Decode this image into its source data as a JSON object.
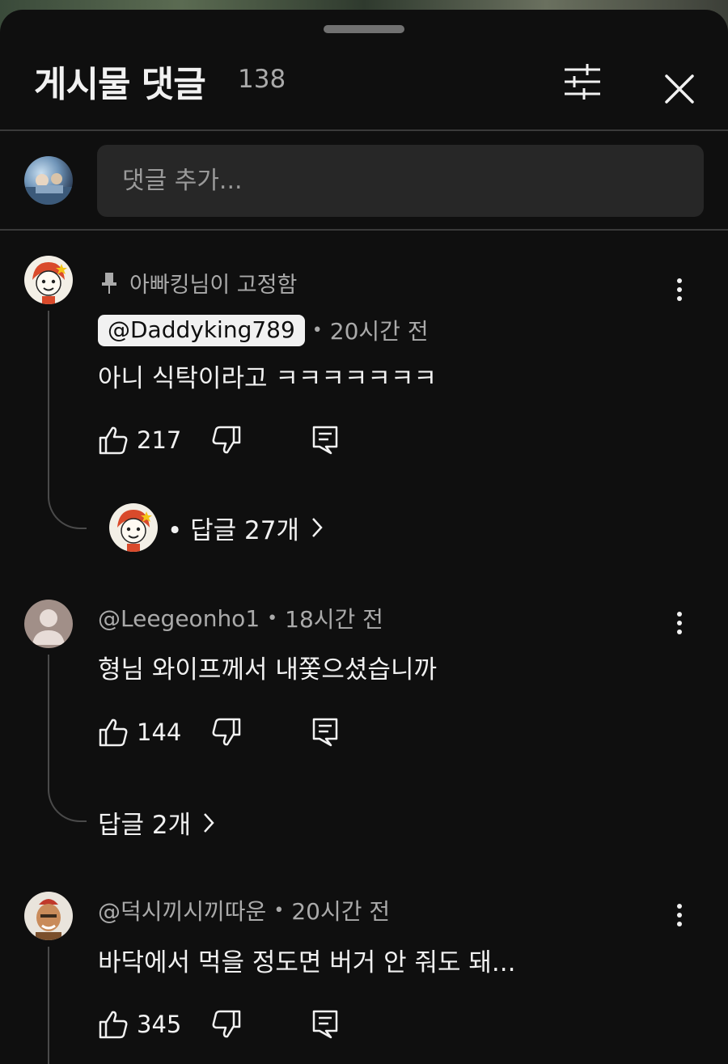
{
  "header": {
    "title": "게시물 댓글",
    "count": "138"
  },
  "composer": {
    "placeholder": "댓글 추가..."
  },
  "comments": [
    {
      "pinned_label": "아빠킹님이 고정함",
      "author": "@Daddyking789",
      "time": "20시간 전",
      "text": "아니 식탁이라고 ㅋㅋㅋㅋㅋㅋㅋ",
      "likes": "217",
      "replies_label": "• 답글 27개"
    },
    {
      "author": "@Leegeonho1",
      "time": "18시간 전",
      "text": "형님 와이프께서 내쫓으셨습니까",
      "likes": "144",
      "replies_label": "답글 2개"
    },
    {
      "author": "@덕시끼시끼따운",
      "time": "20시간 전",
      "text": "바닥에서 먹을 정도면 버거 안 줘도 돼...",
      "likes": "345"
    }
  ],
  "colors": {
    "background": "#0f0f0f",
    "input": "#272727",
    "secondary_text": "#aaaaaa",
    "chip": "#f1f1f1"
  }
}
